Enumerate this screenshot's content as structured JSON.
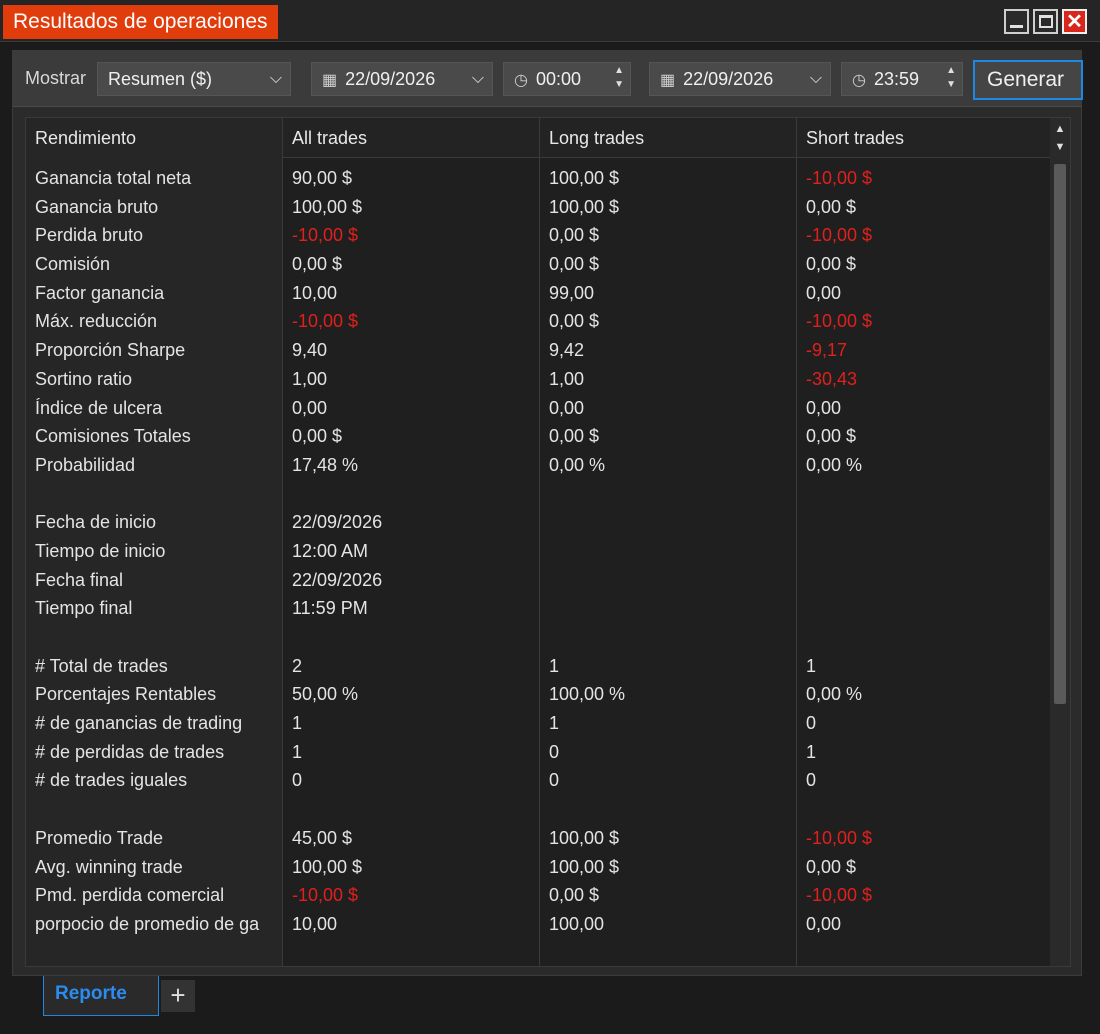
{
  "window": {
    "title": "Resultados de operaciones",
    "minimize_icon": "minimize-icon",
    "maximize_icon": "maximize-icon",
    "close_icon": "close-icon",
    "close_glyph": "✕"
  },
  "toolbar": {
    "show_label": "Mostrar",
    "view_select": {
      "value": "Resumen ($)"
    },
    "start_date": "22/09/2026",
    "start_time": "00:00",
    "end_date": "22/09/2026",
    "end_time": "23:59",
    "generate_label": "Generar"
  },
  "table": {
    "headers": [
      "Rendimiento",
      "All trades",
      "Long trades",
      "Short trades"
    ],
    "rows": [
      {
        "label": "Ganancia total neta",
        "all": "90,00 $",
        "long": "100,00 $",
        "short": "-10,00 $",
        "neg": [
          false,
          false,
          true
        ]
      },
      {
        "label": "Ganancia bruto",
        "all": "100,00 $",
        "long": "100,00 $",
        "short": "0,00 $",
        "neg": [
          false,
          false,
          false
        ]
      },
      {
        "label": "Perdida bruto",
        "all": "-10,00 $",
        "long": "0,00 $",
        "short": "-10,00 $",
        "neg": [
          true,
          false,
          true
        ]
      },
      {
        "label": "Comisión",
        "all": "0,00 $",
        "long": "0,00 $",
        "short": "0,00 $",
        "neg": [
          false,
          false,
          false
        ]
      },
      {
        "label": "Factor ganancia",
        "all": "10,00",
        "long": "99,00",
        "short": "0,00",
        "neg": [
          false,
          false,
          false
        ]
      },
      {
        "label": "Máx. reducción",
        "all": "-10,00 $",
        "long": "0,00 $",
        "short": "-10,00 $",
        "neg": [
          true,
          false,
          true
        ]
      },
      {
        "label": "Proporción Sharpe",
        "all": "9,40",
        "long": "9,42",
        "short": "-9,17",
        "neg": [
          false,
          false,
          true
        ]
      },
      {
        "label": "Sortino ratio",
        "all": "1,00",
        "long": "1,00",
        "short": "-30,43",
        "neg": [
          false,
          false,
          true
        ]
      },
      {
        "label": "Índice de ulcera",
        "all": "0,00",
        "long": "0,00",
        "short": "0,00",
        "neg": [
          false,
          false,
          false
        ]
      },
      {
        "label": "Comisiones Totales",
        "all": "0,00 $",
        "long": "0,00 $",
        "short": "0,00 $",
        "neg": [
          false,
          false,
          false
        ]
      },
      {
        "label": "Probabilidad",
        "all": "17,48 %",
        "long": "0,00 %",
        "short": "0,00 %",
        "neg": [
          false,
          false,
          false
        ]
      },
      {
        "spacer": true
      },
      {
        "label": "Fecha de inicio",
        "all": "22/09/2026",
        "long": "",
        "short": "",
        "neg": [
          false,
          false,
          false
        ]
      },
      {
        "label": "Tiempo de inicio",
        "all": "12:00 AM",
        "long": "",
        "short": "",
        "neg": [
          false,
          false,
          false
        ]
      },
      {
        "label": "Fecha final",
        "all": "22/09/2026",
        "long": "",
        "short": "",
        "neg": [
          false,
          false,
          false
        ]
      },
      {
        "label": "Tiempo final",
        "all": "11:59 PM",
        "long": "",
        "short": "",
        "neg": [
          false,
          false,
          false
        ]
      },
      {
        "spacer": true
      },
      {
        "label": "# Total de trades",
        "all": "2",
        "long": "1",
        "short": "1",
        "neg": [
          false,
          false,
          false
        ]
      },
      {
        "label": "Porcentajes Rentables",
        "all": "50,00 %",
        "long": "100,00 %",
        "short": "0,00 %",
        "neg": [
          false,
          false,
          false
        ]
      },
      {
        "label": "# de ganancias de trading",
        "all": "1",
        "long": "1",
        "short": "0",
        "neg": [
          false,
          false,
          false
        ]
      },
      {
        "label": "# de perdidas de trades",
        "all": "1",
        "long": "0",
        "short": "1",
        "neg": [
          false,
          false,
          false
        ]
      },
      {
        "label": "# de trades iguales",
        "all": "0",
        "long": "0",
        "short": "0",
        "neg": [
          false,
          false,
          false
        ]
      },
      {
        "spacer": true
      },
      {
        "label": "Promedio Trade",
        "all": "45,00 $",
        "long": "100,00 $",
        "short": "-10,00 $",
        "neg": [
          false,
          false,
          true
        ]
      },
      {
        "label": "Avg. winning trade",
        "all": "100,00 $",
        "long": "100,00 $",
        "short": "0,00 $",
        "neg": [
          false,
          false,
          false
        ]
      },
      {
        "label": "Pmd. perdida comercial",
        "all": "-10,00 $",
        "long": "0,00 $",
        "short": "-10,00 $",
        "neg": [
          true,
          false,
          true
        ]
      },
      {
        "label": "porpocio de promedio de ga",
        "all": "10,00",
        "long": "100,00",
        "short": "0,00",
        "neg": [
          false,
          false,
          false
        ]
      }
    ]
  },
  "tabs": {
    "active_label": "Reporte",
    "add_glyph": "+"
  },
  "colors": {
    "accent_orange": "#e03c0c",
    "negative_red": "#e0201c",
    "focus_blue": "#1e88e5"
  }
}
